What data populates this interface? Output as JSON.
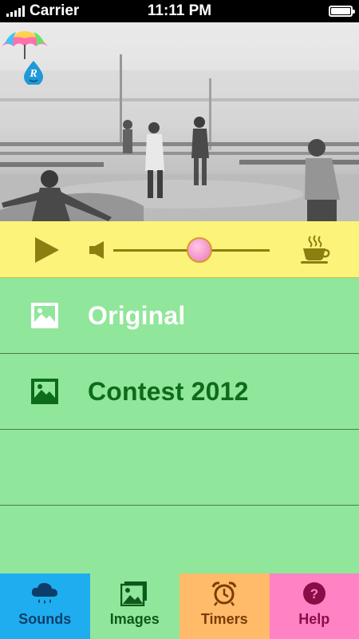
{
  "status_bar": {
    "carrier": "Carrier",
    "time": "11:11 PM"
  },
  "player": {
    "volume_level": 0.55,
    "play_icon": "play-icon",
    "volume_icon": "speaker-icon",
    "timer_icon": "coffee-cup-icon"
  },
  "image_list": {
    "items": [
      {
        "label": "Original",
        "selected": true
      },
      {
        "label": "Contest 2012",
        "selected": false
      }
    ]
  },
  "tabs": [
    {
      "label": "Sounds",
      "icon": "rain-cloud-icon",
      "color": "#1eaef0"
    },
    {
      "label": "Images",
      "icon": "images-icon",
      "color": "#90e69a",
      "active": true
    },
    {
      "label": "Timers",
      "icon": "alarm-clock-icon",
      "color": "#ffbb6a"
    },
    {
      "label": "Help",
      "icon": "help-icon",
      "color": "#ff82c4"
    }
  ],
  "colors": {
    "player_bar": "#fcf37a",
    "list_background": "#90e69a",
    "accent_knob": "#f59acb"
  }
}
